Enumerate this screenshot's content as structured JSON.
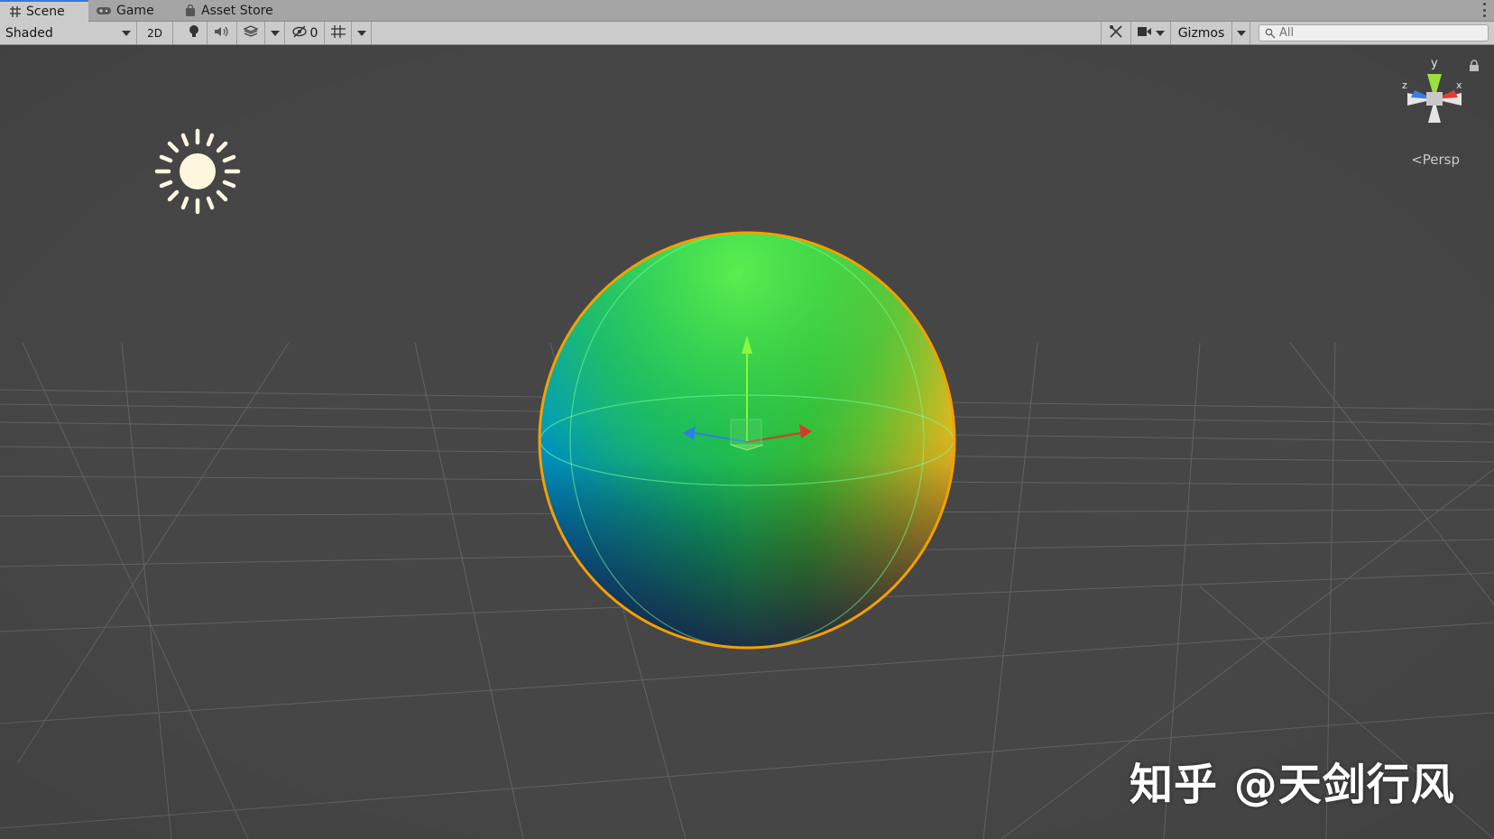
{
  "tabs": [
    {
      "label": "Scene",
      "icon": "grid-icon",
      "active": true
    },
    {
      "label": "Game",
      "icon": "gamepad-icon",
      "active": false
    },
    {
      "label": "Asset Store",
      "icon": "bag-icon",
      "active": false
    }
  ],
  "toolbar": {
    "draw_mode": "Shaded",
    "mode_2d": "2D",
    "hidden_count": "0",
    "gizmos_label": "Gizmos",
    "search_placeholder": "All"
  },
  "viewport": {
    "projection_label": "<Persp",
    "axis_labels": {
      "y": "y",
      "x": "x",
      "z": "z"
    },
    "watermark": "知乎 @天剑行风"
  },
  "colors": {
    "accent": "#3a79d6",
    "viewport_bg": "#464646",
    "selection_outline": "#f5a000"
  }
}
